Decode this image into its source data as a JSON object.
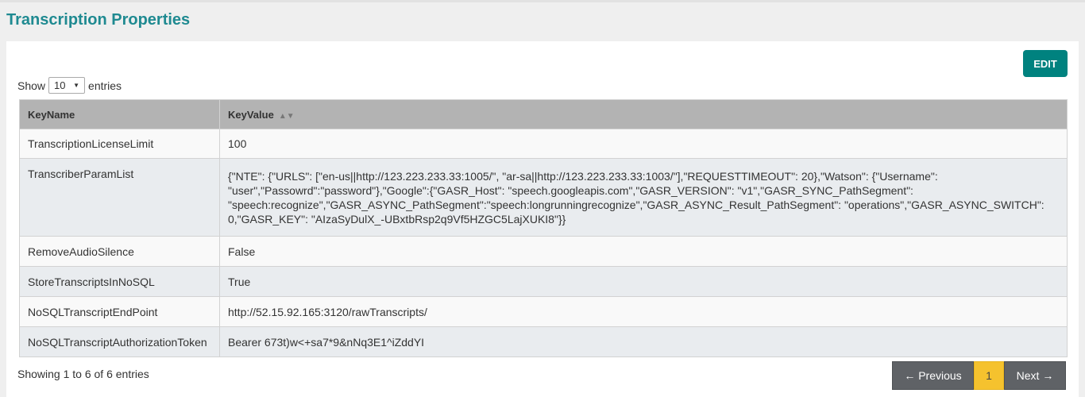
{
  "page": {
    "title": "Transcription Properties"
  },
  "toolbar": {
    "edit_label": "EDIT"
  },
  "length": {
    "show": "Show",
    "selected": "10",
    "entries": "entries"
  },
  "table": {
    "headers": [
      "KeyName",
      "KeyValue"
    ],
    "rows": [
      {
        "key": "TranscriptionLicenseLimit",
        "value": "100"
      },
      {
        "key": "TranscriberParamList",
        "value": "{\"NTE\": {\"URLS\": [\"en-us||http://123.223.233.33:1005/\", \"ar-sa||http://123.223.233.33:1003/\"],\"REQUESTTIMEOUT\": 20},\"Watson\": {\"Username\": \"user\",\"Passowrd\":\"password\"},\"Google\":{\"GASR_Host\": \"speech.googleapis.com\",\"GASR_VERSION\": \"v1\",\"GASR_SYNC_PathSegment\": \"speech:recognize\",\"GASR_ASYNC_PathSegment\":\"speech:longrunningrecognize\",\"GASR_ASYNC_Result_PathSegment\": \"operations\",\"GASR_ASYNC_SWITCH\": 0,\"GASR_KEY\": \"AIzaSyDulX_-UBxtbRsp2q9Vf5HZGC5LajXUKI8\"}}"
      },
      {
        "key": "RemoveAudioSilence",
        "value": "False"
      },
      {
        "key": "StoreTranscriptsInNoSQL",
        "value": "True"
      },
      {
        "key": "NoSQLTranscriptEndPoint",
        "value": "http://52.15.92.165:3120/rawTranscripts/"
      },
      {
        "key": "NoSQLTranscriptAuthorizationToken",
        "value": "Bearer 673t)w<+sa7*9&nNq3E1^iZddYI"
      }
    ]
  },
  "info": "Showing 1 to 6 of 6 entries",
  "pagination": {
    "previous": "← Previous",
    "current": "1",
    "next": "Next →"
  },
  "icons": {
    "sort": "sort-icon",
    "dropdown": "chevron-down-icon"
  },
  "colors": {
    "title": "#1f8a91",
    "edit_button": "#00827f",
    "header_bg": "#b3b3b3",
    "page_current": "#f5c22e",
    "pager_bg": "#5f6266"
  }
}
